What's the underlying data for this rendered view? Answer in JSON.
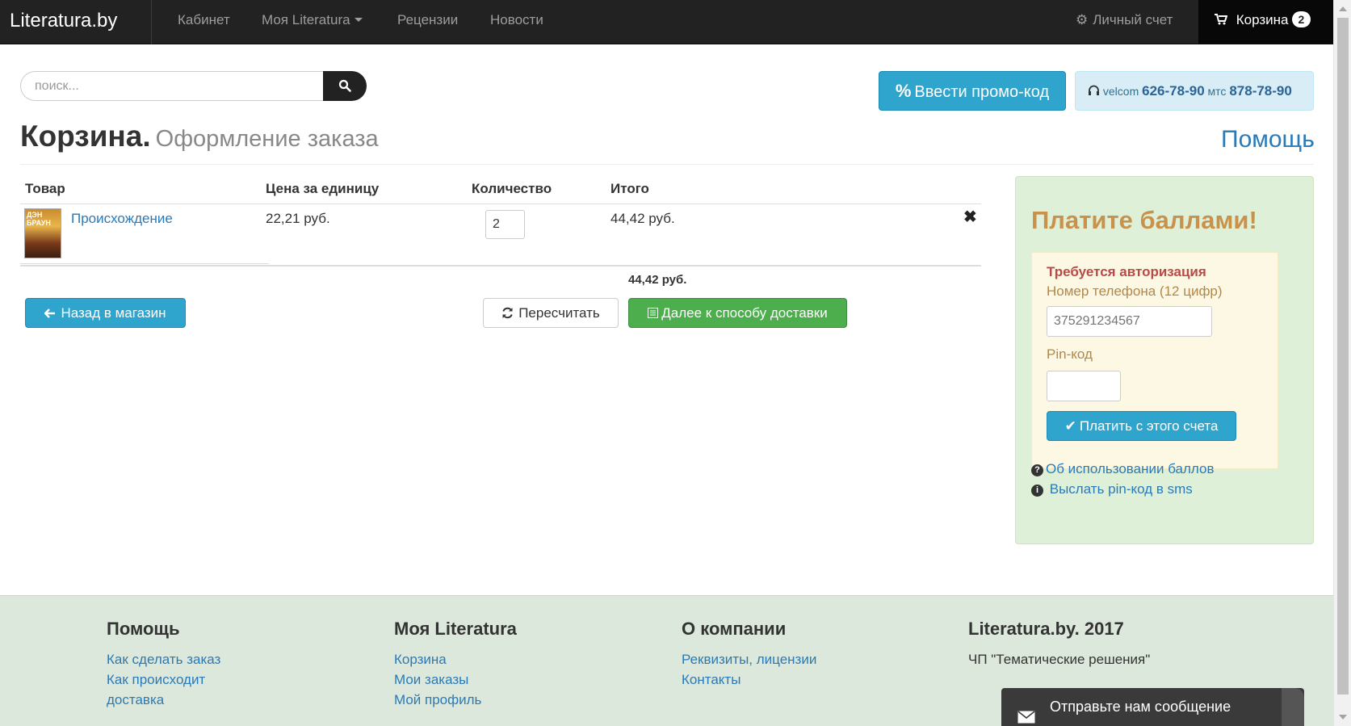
{
  "navbar": {
    "brand": "Literatura.by",
    "items": [
      "Кабинет",
      "Моя Literatura",
      "Рецензии",
      "Новости"
    ],
    "account": "Личный счет",
    "cart_label": "Корзина",
    "cart_count": "2"
  },
  "search": {
    "placeholder": "поиск..."
  },
  "promo": {
    "symbol": "%",
    "label": "Ввести промо-код"
  },
  "phones": {
    "op1": "velcom",
    "num1": "626-78-90",
    "op2": "мтс",
    "num2": "878-78-90"
  },
  "page": {
    "title": "Корзина.",
    "subtitle": "Оформление заказа",
    "help": "Помощь"
  },
  "cart": {
    "columns": [
      "Товар",
      "Цена за единицу",
      "Количество",
      "Итого"
    ],
    "items": [
      {
        "cover_text": "ДЭН БРАУН",
        "name": "Происхождение",
        "price": "22,21 руб.",
        "quantity": "2",
        "total": "44,42 руб."
      }
    ],
    "grand_total": "44,42 руб."
  },
  "buttons": {
    "back": "Назад в магазин",
    "recalc": "Пересчитать",
    "next": "Далее к способу доставки"
  },
  "points": {
    "title": "Платите баллами!",
    "auth_required": "Требуется авторизация",
    "phone_label": "Номер телефона (12 цифр)",
    "phone_placeholder": "375291234567",
    "pin_label": "Pin-код",
    "pay_button": "Платить с этого счета",
    "about_link": "Об использовании баллов",
    "sms_link": "Выслать pin-код в sms"
  },
  "footer": {
    "col1": {
      "title": "Помощь",
      "links": [
        "Как сделать заказ",
        "Как происходит",
        "доставка"
      ]
    },
    "col2": {
      "title": "Моя Literatura",
      "links": [
        "Корзина",
        "Мои заказы",
        "Мой профиль"
      ]
    },
    "col3": {
      "title": "О компании",
      "links": [
        "Реквизиты, лицензии",
        "Контакты"
      ]
    },
    "col4": {
      "title": "Literatura.by. 2017",
      "text": "ЧП \"Тематические решения\""
    }
  },
  "chat": {
    "label": "Отправьте нам сообщение"
  }
}
